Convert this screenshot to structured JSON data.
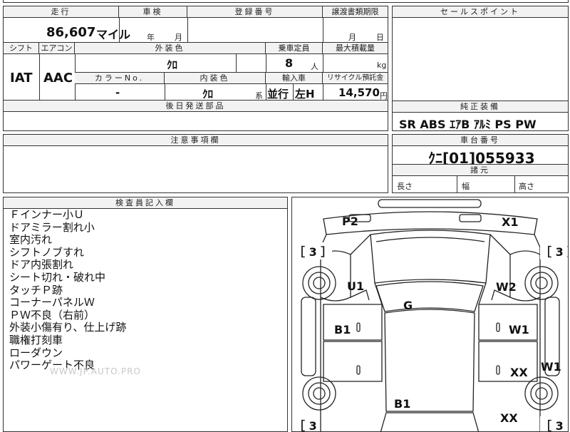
{
  "top_row": {
    "mileage_header": "走行",
    "mileage_value": "86,607",
    "mileage_unit": "マイル",
    "inspection_header": "車検",
    "inspection_year_unit": "年",
    "inspection_month_unit": "月",
    "registration_header": "登録番号",
    "transfer_header": "譲渡書類期限",
    "transfer_month_unit": "月",
    "transfer_day_unit": "日"
  },
  "spec": {
    "shift_header": "シフト",
    "shift_value": "IAT",
    "ac_header": "エアコン",
    "ac_value": "AAC",
    "ext_color_header": "外装色",
    "ext_color_value": "ｸﾛ",
    "capacity_header": "乗車定員",
    "capacity_value": "8",
    "capacity_unit": "人",
    "load_header": "最大積載量",
    "load_unit": "kg",
    "color_no_header": "カラーNo.",
    "color_no_value": "-",
    "int_color_header": "内装色",
    "int_color_value": "ｸﾛ",
    "int_color_suffix": "系",
    "import_header": "輸入車",
    "import_value_1": "並行",
    "import_value_2": "左H",
    "recycle_header": "リサイクル預託金",
    "recycle_value": "14,570",
    "recycle_unit": "円",
    "retrofit_header": "後日発送部品"
  },
  "sales_points": {
    "header": "セールスポイント"
  },
  "equipment": {
    "header": "純正装備",
    "value": "SR  ABS  ｴｱB  ｱﾙﾐ  PS  PW"
  },
  "notes": {
    "header": "注意事項欄"
  },
  "chassis": {
    "header": "車台番号",
    "value": "ｸﾆ[01]055933",
    "dims_header": "諸元",
    "length_label": "長さ",
    "width_label": "幅",
    "height_label": "高さ"
  },
  "inspector": {
    "header": "検査員記入欄",
    "lines": [
      "Ｆインナー小Ｕ",
      "ドアミラー割れ小",
      "室内汚れ",
      "シフトノブすれ",
      "ドア内張割れ",
      "シート切れ・破れ中",
      "タッチＰ跡",
      "コーナーパネルＷ",
      "ＰＷ不良（右前）",
      "外装小傷有り、仕上げ跡",
      "職権打刻車",
      "ローダウン",
      "パワーゲート不良"
    ],
    "watermark": "WWW.JP.AUTO.PRO"
  },
  "diagram": {
    "labels": {
      "p2": "P2",
      "x1": "X1",
      "u1": "U1",
      "w2": "W2",
      "g": "G",
      "b1_left": "B1",
      "w1_right": "W1",
      "w1_edge": "W1",
      "xx_mid": "XX",
      "b1_bottom": "B1",
      "xx_bottom": "XX",
      "tire_tl": "［ 3 ］",
      "tire_tr": "［ 3 ］",
      "tire_bl": "［ 3",
      "tire_br": "［ 3"
    }
  }
}
